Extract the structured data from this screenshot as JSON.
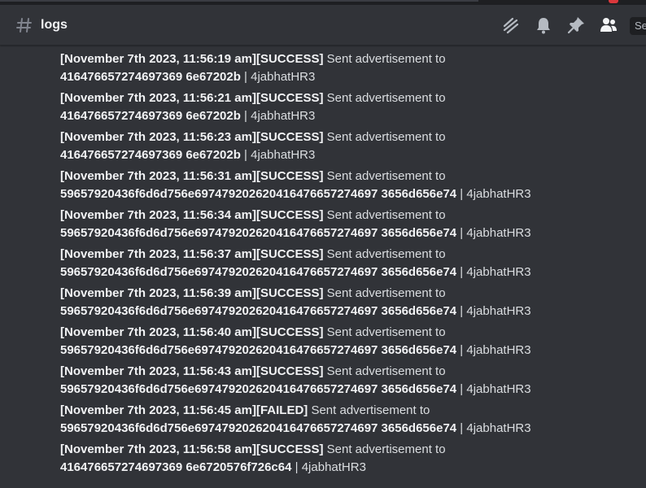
{
  "header": {
    "channel": "logs",
    "search_placeholder": "Se",
    "tools": [
      "threads-icon",
      "bell-icon",
      "pin-icon",
      "members-icon"
    ]
  },
  "colors": {
    "background": "#313338",
    "text": "#dbdee1",
    "bold": "#f2f3f5",
    "icon": "#b5bac1"
  },
  "messages": [
    {
      "stamp": "[November 7th 2023, 11:56:19 am][SUCCESS]",
      "text": " Sent advertisement to",
      "target": "416476657274697369 6e67202b",
      "sep": " | ",
      "user": "4jabhatHR3"
    },
    {
      "stamp": "[November 7th 2023, 11:56:21 am][SUCCESS]",
      "text": " Sent advertisement to",
      "target": "416476657274697369 6e67202b",
      "sep": " | ",
      "user": "4jabhatHR3"
    },
    {
      "stamp": "[November 7th 2023, 11:56:23 am][SUCCESS]",
      "text": " Sent advertisement to",
      "target": "416476657274697369 6e67202b",
      "sep": " | ",
      "user": "4jabhatHR3"
    },
    {
      "stamp": "[November 7th 2023, 11:56:31 am][SUCCESS]",
      "text": " Sent advertisement to",
      "target": "59657920436f6d6d756e697479202620416476657274697 3656d656e74",
      "sep": " | ",
      "user": "4jabhatHR3"
    },
    {
      "stamp": "[November 7th 2023, 11:56:34 am][SUCCESS]",
      "text": " Sent advertisement to",
      "target": "59657920436f6d6d756e697479202620416476657274697 3656d656e74",
      "sep": " | ",
      "user": "4jabhatHR3"
    },
    {
      "stamp": "[November 7th 2023, 11:56:37 am][SUCCESS]",
      "text": " Sent advertisement to",
      "target": "59657920436f6d6d756e697479202620416476657274697 3656d656e74",
      "sep": " | ",
      "user": "4jabhatHR3"
    },
    {
      "stamp": "[November 7th 2023, 11:56:39 am][SUCCESS]",
      "text": " Sent advertisement to",
      "target": "59657920436f6d6d756e697479202620416476657274697 3656d656e74",
      "sep": " | ",
      "user": "4jabhatHR3"
    },
    {
      "stamp": "[November 7th 2023, 11:56:40 am][SUCCESS]",
      "text": " Sent advertisement to",
      "target": "59657920436f6d6d756e697479202620416476657274697 3656d656e74",
      "sep": " | ",
      "user": "4jabhatHR3"
    },
    {
      "stamp": "[November 7th 2023, 11:56:43 am][SUCCESS]",
      "text": " Sent advertisement to",
      "target": "59657920436f6d6d756e697479202620416476657274697 3656d656e74",
      "sep": " | ",
      "user": "4jabhatHR3"
    },
    {
      "stamp": "[November 7th 2023, 11:56:45 am][FAILED]",
      "text": " Sent advertisement to",
      "target": "59657920436f6d6d756e697479202620416476657274697 3656d656e74",
      "sep": " | ",
      "user": "4jabhatHR3"
    },
    {
      "stamp": "[November 7th 2023, 11:56:58 am][SUCCESS]",
      "text": " Sent advertisement to",
      "target": "416476657274697369 6e6720576f726c64",
      "sep": " | ",
      "user": "4jabhatHR3"
    }
  ]
}
